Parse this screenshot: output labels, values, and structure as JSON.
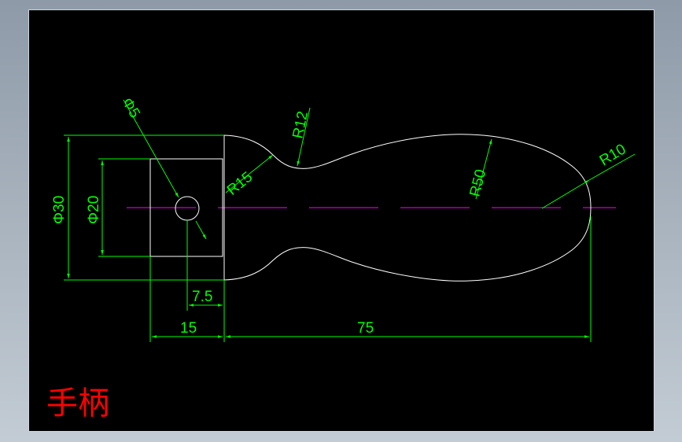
{
  "title": "手柄",
  "colors": {
    "background": "#000000",
    "outline": "#ffffff",
    "dimension": "#00ff00",
    "centerline": "#ff00ff",
    "title": "#ff0000"
  },
  "dimensions": {
    "hole_diameter": "Φ5",
    "overall_diameter": "Φ30",
    "head_diameter": "Φ20",
    "radius_neck": "R12",
    "radius_shoulder": "R15",
    "radius_body": "R50",
    "radius_end": "R10",
    "offset_hole": "7.5",
    "length_head": "15",
    "length_body": "75"
  }
}
